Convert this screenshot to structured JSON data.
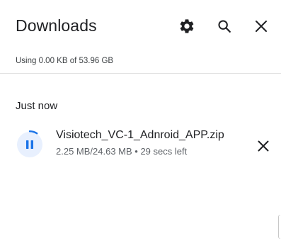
{
  "header": {
    "title": "Downloads",
    "icons": {
      "settings": "gear-icon",
      "search": "search-icon",
      "close": "close-icon"
    }
  },
  "storage": {
    "text": "Using 0.00 KB of 53.96 GB"
  },
  "section": {
    "label": "Just now"
  },
  "download": {
    "file_name": "Visiotech_VC-1_Adnroid_APP.zip",
    "status": "2.25 MB/24.63 MB • 29 secs left",
    "progress_fraction": 0.091,
    "state_icon": "pause-icon",
    "cancel_icon": "close-icon"
  },
  "colors": {
    "accent": "#1a73e8",
    "icon_tint_bg": "#e8f0fe",
    "text_primary": "#202124",
    "text_secondary": "#5f6368"
  }
}
